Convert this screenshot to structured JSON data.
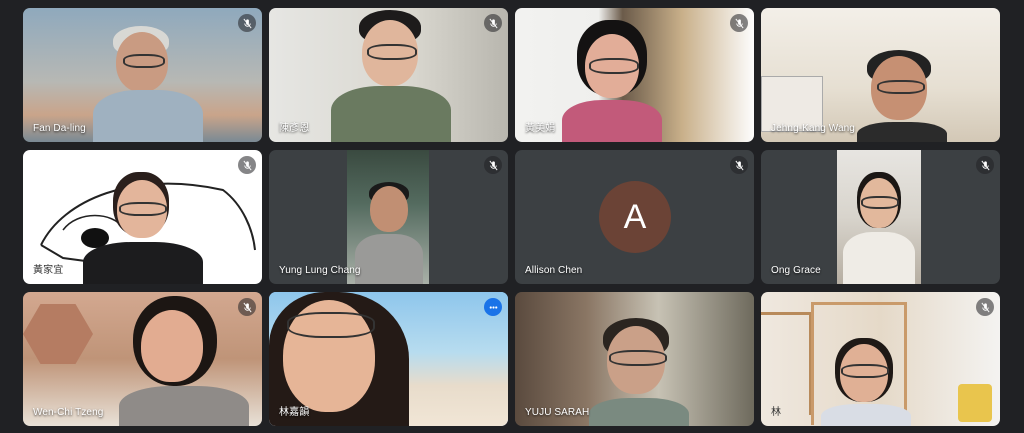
{
  "participants": [
    {
      "name": "Fan Da-ling",
      "muted": true
    },
    {
      "name": "陳彥恩",
      "muted": true
    },
    {
      "name": "黃美娟",
      "muted": true
    },
    {
      "name": "Jehng-Kang Wang",
      "muted": false
    },
    {
      "name": "黃家宜",
      "muted": true
    },
    {
      "name": "Yung Lung Chang",
      "muted": true
    },
    {
      "name": "Allison Chen",
      "muted": true,
      "avatar_letter": "A"
    },
    {
      "name": "Ong Grace",
      "muted": true
    },
    {
      "name": "Wen-Chi Tzeng",
      "muted": true
    },
    {
      "name": "林嘉韻",
      "muted": false,
      "speaking": true
    },
    {
      "name": "YUJU SARAH",
      "muted": false
    },
    {
      "name": "林",
      "muted": true
    }
  ],
  "colors": {
    "background": "#202124",
    "tile": "#3c4043",
    "accent": "#1a73e8",
    "avatar": "#6b4336"
  }
}
